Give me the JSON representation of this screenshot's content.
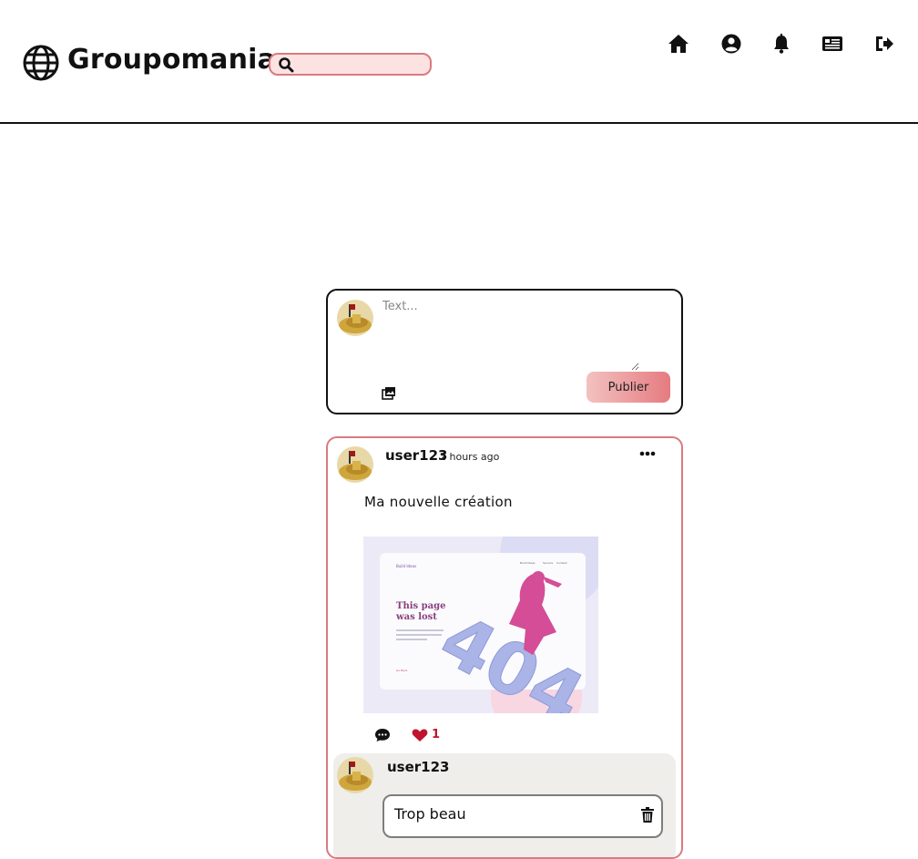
{
  "app": {
    "brand": "Groupomania"
  },
  "search": {
    "placeholder": ""
  },
  "nav": {
    "items": [
      {
        "name": "home-icon"
      },
      {
        "name": "user-circle-icon"
      },
      {
        "name": "bell-icon"
      },
      {
        "name": "newspaper-icon"
      },
      {
        "name": "logout-icon"
      }
    ]
  },
  "composer": {
    "placeholder": "Text...",
    "publish_label": "Publier",
    "upload_icon": "images-icon"
  },
  "post": {
    "author": "user123",
    "time": "2 hours ago",
    "text": "Ma nouvelle création",
    "image": {
      "title_line1": "This page",
      "title_line2": "was lost",
      "big_text": "404",
      "nav_links": [
        "Build Ideas",
        "Service",
        "Contact"
      ],
      "brand": "Build Ideas",
      "back_link": "Go Back"
    },
    "like_count": "1",
    "colors": {
      "accent": "#d97a80",
      "like": "#c0142e"
    }
  },
  "comment": {
    "author": "user123",
    "text": "Trop beau"
  }
}
